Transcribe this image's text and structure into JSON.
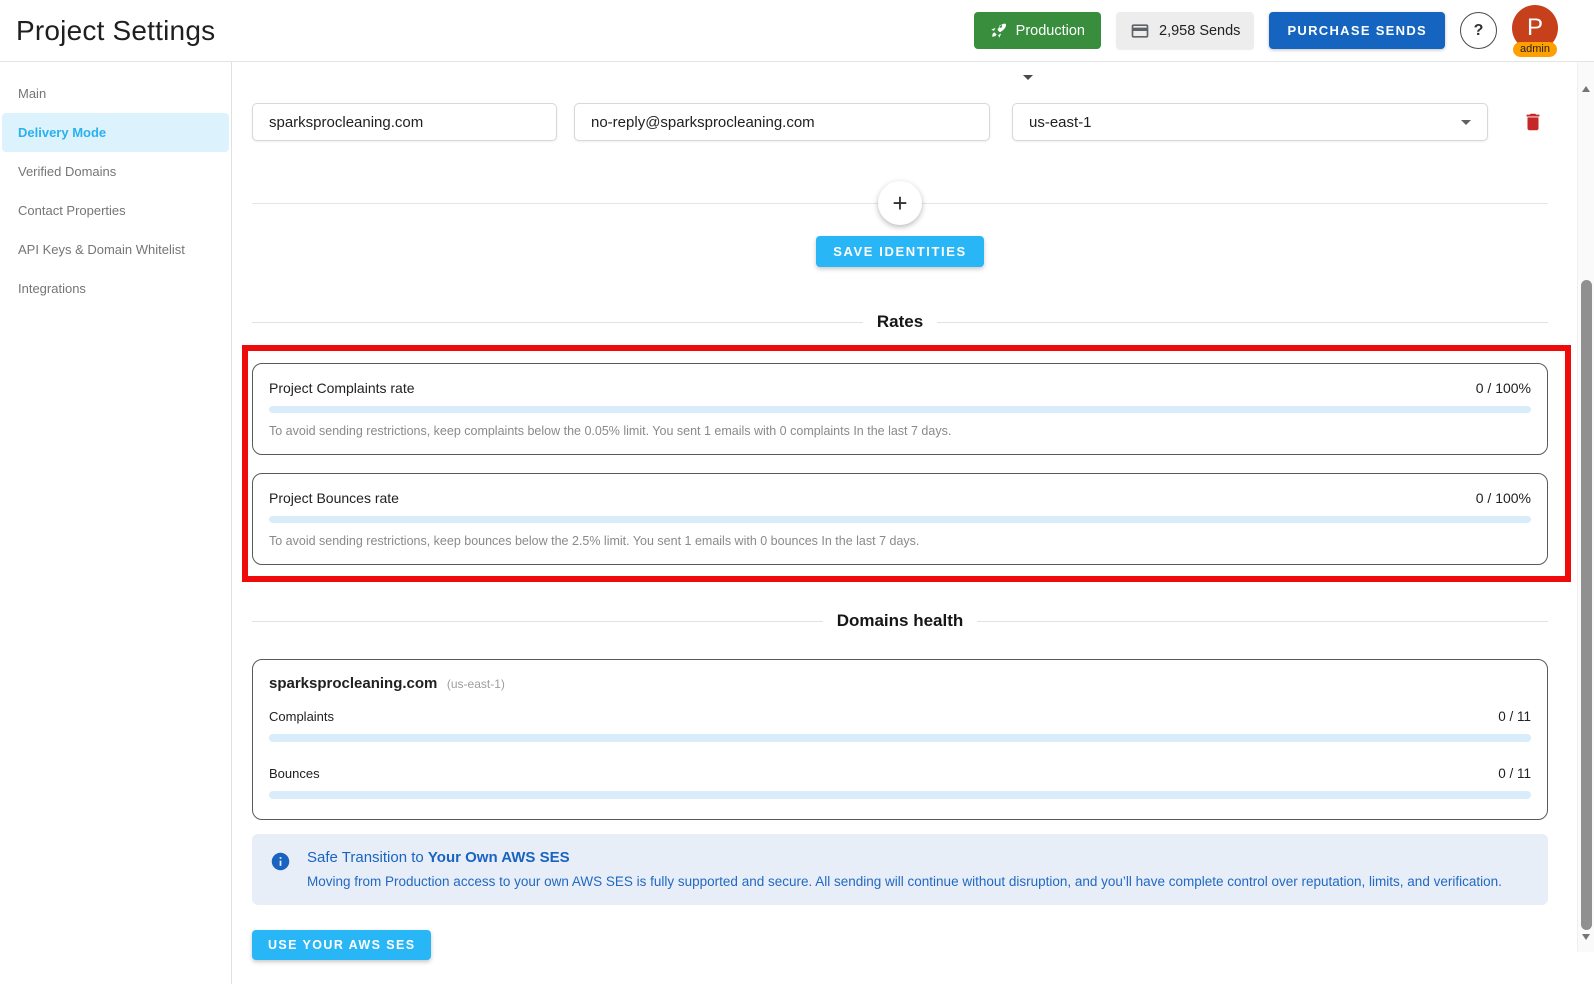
{
  "header": {
    "title": "Project Settings",
    "production_button": "Production",
    "sends_chip": "2,958 Sends",
    "purchase_button": "PURCHASE SENDS",
    "help_button": "?",
    "avatar_letter": "P",
    "avatar_badge": "admin"
  },
  "sidebar": {
    "items": [
      {
        "label": "Main",
        "active": false
      },
      {
        "label": "Delivery Mode",
        "active": true
      },
      {
        "label": "Verified Domains",
        "active": false
      },
      {
        "label": "Contact Properties",
        "active": false
      },
      {
        "label": "API Keys & Domain Whitelist",
        "active": false
      },
      {
        "label": "Integrations",
        "active": false
      }
    ]
  },
  "identities": {
    "domain_value": "sparksprocleaning.com",
    "email_value": "no-reply@sparksprocleaning.com",
    "region_value": "us-east-1",
    "add_button": "+",
    "save_button": "SAVE IDENTITIES"
  },
  "rates": {
    "heading": "Rates",
    "cards": [
      {
        "title": "Project Complaints rate",
        "value": "0 / 100%",
        "progress_percent": 0,
        "caption": "To avoid sending restrictions, keep complaints below the 0.05% limit. You sent 1 emails with 0 complaints In the last 7 days."
      },
      {
        "title": "Project Bounces rate",
        "value": "0 / 100%",
        "progress_percent": 0,
        "caption": "To avoid sending restrictions, keep bounces below the 2.5% limit. You sent 1 emails with 0 bounces In the last 7 days."
      }
    ]
  },
  "domains_health": {
    "heading": "Domains health",
    "domain": "sparksprocleaning.com",
    "region": "(us-east-1)",
    "metrics": [
      {
        "label": "Complaints",
        "value": "0 / 11",
        "progress_percent": 0
      },
      {
        "label": "Bounces",
        "value": "0 / 11",
        "progress_percent": 0
      }
    ]
  },
  "aws_alert": {
    "title_normal": "Safe Transition to ",
    "title_bold": "Your Own AWS SES",
    "body": "Moving from Production access to your own AWS SES is fully supported and secure. All sending will continue without disruption, and you’ll have complete control over reputation, limits, and verification.",
    "action_button": "USE YOUR AWS SES"
  },
  "colors": {
    "production_green": "#388e3c",
    "purchase_blue": "#1565c0",
    "accent_cyan": "#29b6f6",
    "annotation_red": "#ef0b0b",
    "avatar_orange_red": "#c6401c",
    "badge_orange": "#ffa000",
    "progress_track_blue": "#d9ecf9",
    "alert_background": "#e7eef8",
    "alert_text_blue": "#1a63c0",
    "delete_red": "#c62828",
    "sidebar_active_bg": "#dcf2fd"
  }
}
